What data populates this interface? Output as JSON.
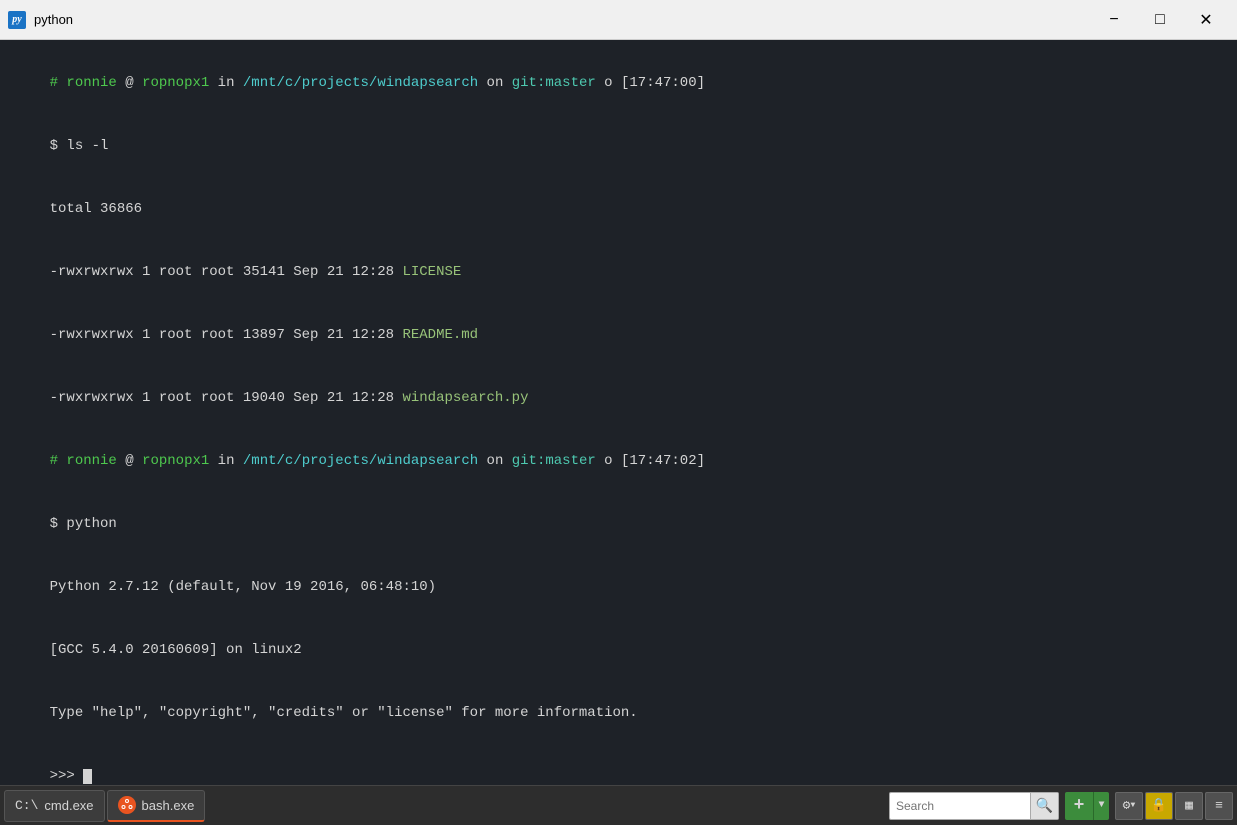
{
  "titlebar": {
    "icon_text": "py",
    "title": "python",
    "minimize_label": "−",
    "maximize_label": "□",
    "close_label": "✕"
  },
  "terminal": {
    "prompt1": {
      "hash": "#",
      "user": "ronnie",
      "at": "@",
      "host": "ropnopx1",
      "in": "in",
      "path": "/mnt/c/projects/windapsearch",
      "on": "on",
      "git_label": "git:",
      "branch": "master",
      "marker": "o",
      "time": "[17:47:00]"
    },
    "cmd1": {
      "dollar": "$",
      "cmd": "ls -l"
    },
    "total_line": "total 36866",
    "files": [
      {
        "perms": "-rwxrwxrwx",
        "links": "1",
        "owner": "root",
        "group": "root",
        "size": "35141",
        "date": "Sep 21 12:28",
        "name": "LICENSE"
      },
      {
        "perms": "-rwxrwxrwx",
        "links": "1",
        "owner": "root",
        "group": "root",
        "size": "13897",
        "date": "Sep 21 12:28",
        "name": "README.md"
      },
      {
        "perms": "-rwxrwxrwx",
        "links": "1",
        "owner": "root",
        "group": "root",
        "size": "19040",
        "date": "Sep 21 12:28",
        "name": "windapsearch.py"
      }
    ],
    "prompt2": {
      "hash": "#",
      "user": "ronnie",
      "at": "@",
      "host": "ropnopx1",
      "in": "in",
      "path": "/mnt/c/projects/windapsearch",
      "on": "on",
      "git_label": "git:",
      "branch": "master",
      "marker": "o",
      "time": "[17:47:02]"
    },
    "cmd2": {
      "dollar": "$",
      "cmd": "python"
    },
    "python_version": "Python 2.7.12 (default, Nov 19 2016, 06:48:10)",
    "gcc_line": "[GCC 5.4.0 20160609] on linux2",
    "type_line": "Type \"help\", \"copyright\", \"credits\" or \"license\" for more information.",
    "repl_prompt": ">>>"
  },
  "taskbar": {
    "cmd_label": "cmd.exe",
    "bash_label": "bash.exe",
    "search_placeholder": "Search",
    "search_value": ""
  }
}
